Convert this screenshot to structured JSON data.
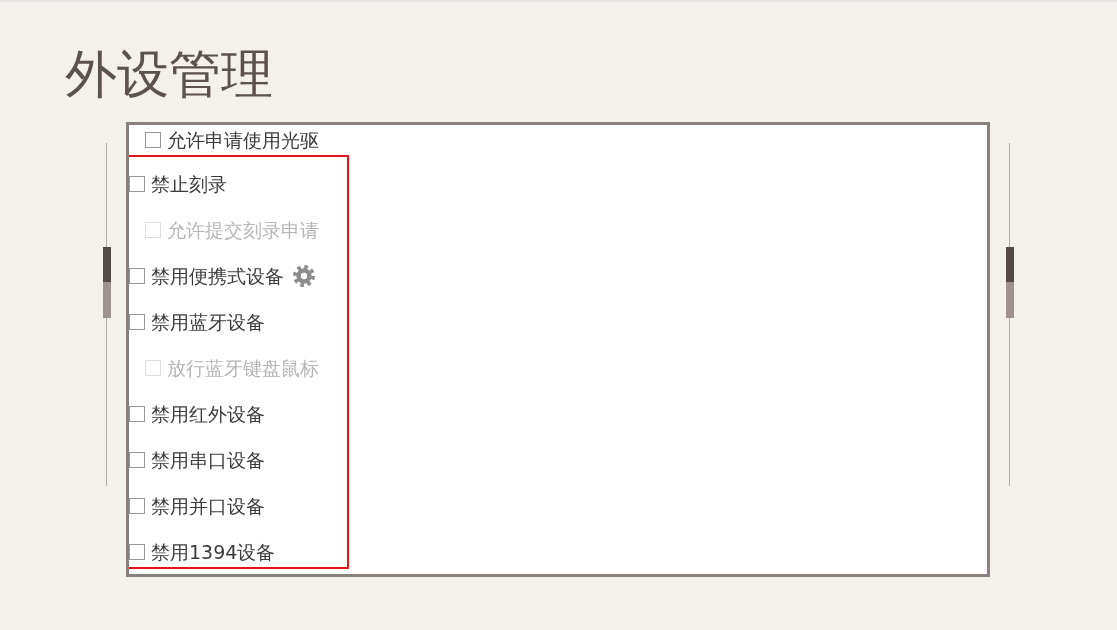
{
  "title": "外设管理",
  "screenshot": {
    "options": [
      {
        "children": [
          {
            "label": "允许申请使用光驱",
            "checked": false,
            "disabled": false
          }
        ]
      }
    ],
    "highlight_box": {
      "options": [
        {
          "label": "禁止刻录",
          "checked": false,
          "disabled": false,
          "children": [
            {
              "label": "允许提交刻录申请",
              "checked": false,
              "disabled": true
            }
          ]
        },
        {
          "label": "禁用便携式设备",
          "checked": false,
          "disabled": false,
          "settings": true
        },
        {
          "label": "禁用蓝牙设备",
          "checked": false,
          "disabled": false,
          "children": [
            {
              "label": "放行蓝牙键盘鼠标",
              "checked": false,
              "disabled": true
            }
          ]
        },
        {
          "label": "禁用红外设备",
          "checked": false,
          "disabled": false
        },
        {
          "label": "禁用串口设备",
          "checked": false,
          "disabled": false
        },
        {
          "label": "禁用并口设备",
          "checked": false,
          "disabled": false
        },
        {
          "label": "禁用1394设备",
          "checked": false,
          "disabled": false
        }
      ]
    }
  }
}
